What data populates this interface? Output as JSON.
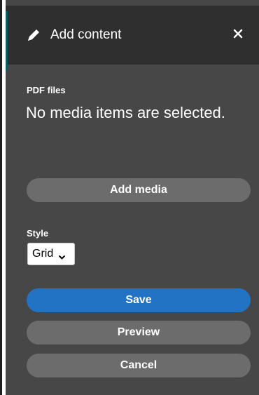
{
  "dialog": {
    "title": "Add content",
    "icons": {
      "header": "pencil-icon",
      "close": "close-icon"
    }
  },
  "pdf_files": {
    "label": "PDF files",
    "status_text": "No media items are selected.",
    "add_button_label": "Add media"
  },
  "style": {
    "label": "Style",
    "selected_value": "Grid"
  },
  "actions": {
    "save_label": "Save",
    "preview_label": "Preview",
    "cancel_label": "Cancel"
  },
  "colors": {
    "panel_background": "#474747",
    "header_background": "#2f2f2f",
    "primary_button": "#2273c3",
    "secondary_button": "#6c6c6c",
    "accent_stripe": "#0a5f5e"
  }
}
